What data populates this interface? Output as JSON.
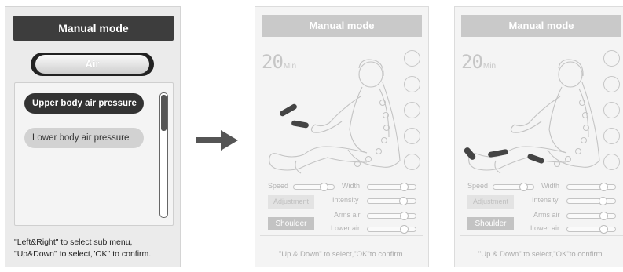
{
  "panel1": {
    "title": "Manual mode",
    "category": "Air",
    "options": [
      "Upper body air pressure",
      "Lower body air pressure"
    ],
    "hint_line1": "\"Left&Right\" to select sub menu,",
    "hint_line2": "\"Up&Down\" to select,\"OK\" to confirm."
  },
  "screen": {
    "title": "Manual mode",
    "timer_value": "20",
    "timer_unit": "Min",
    "labels": {
      "speed": "Speed",
      "width": "Width",
      "intensity": "Intensity",
      "arms_air": "Arms air",
      "lower_air": "Lower air"
    },
    "buttons": {
      "adjustment": "Adjustment",
      "shoulder": "Shoulder"
    },
    "hint": "\"Up & Down\" to select,\"OK\"to confirm."
  },
  "sliders": {
    "speed": 0.82,
    "width": 0.82,
    "intensity": 0.8,
    "arms_air": 0.82,
    "lower_air": 0.82
  },
  "colors": {
    "dark_title": "#3d3d3d",
    "muted_title": "#c9c9c9",
    "highlight": "#444444"
  }
}
